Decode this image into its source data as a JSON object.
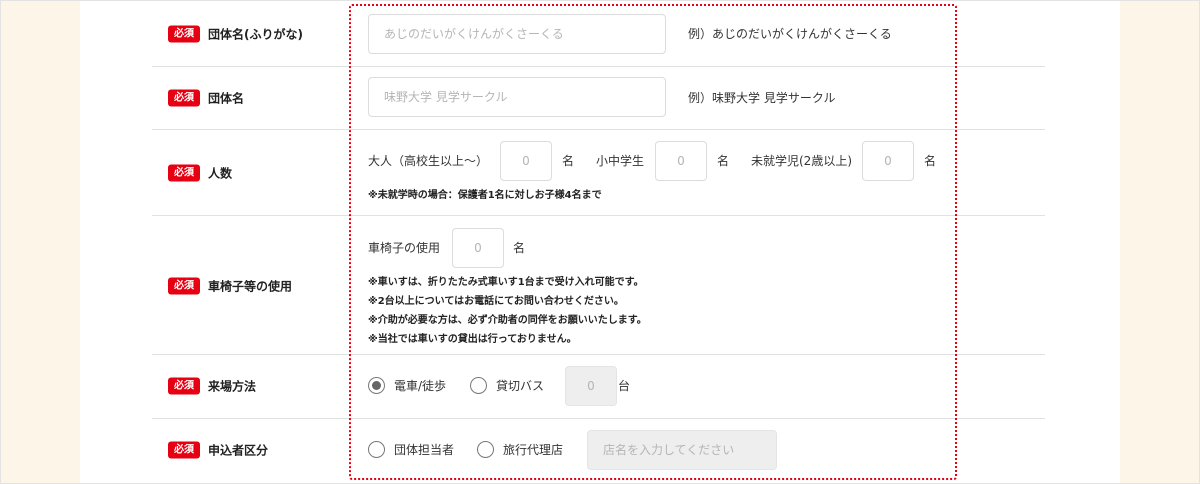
{
  "required_badge": "必須",
  "rows": {
    "group_kana": {
      "label": "団体名(ふりがな)",
      "placeholder": "あじのだいがくけんがくさーくる",
      "example": "例）あじのだいがくけんがくさーくる"
    },
    "group_name": {
      "label": "団体名",
      "placeholder": "味野大学 見学サークル",
      "example": "例）味野大学 見学サークル"
    },
    "headcount": {
      "label": "人数",
      "adult_label": "大人（高校生以上〜）",
      "adult_value": "0",
      "child_label": "小中学生",
      "child_value": "0",
      "infant_label": "未就学児(2歳以上)",
      "infant_value": "0",
      "unit": "名",
      "note": "※未就学時の場合：保護者1名に対しお子様4名まで"
    },
    "wheelchair": {
      "label": "車椅子等の使用",
      "field_label": "車椅子の使用",
      "value": "0",
      "unit": "名",
      "notes": [
        "※車いすは、折りたたみ式車いす1台まで受け入れ可能です。",
        "※2台以上についてはお電話にてお問い合わせください。",
        "※介助が必要な方は、必ず介助者の同伴をお願いいたします。",
        "※当社では車いすの貸出は行っておりません。"
      ]
    },
    "transport": {
      "label": "来場方法",
      "option_train": "電車/徒歩",
      "option_bus": "貸切バス",
      "bus_count": "0",
      "bus_unit": "台",
      "selected": "電車/徒歩"
    },
    "applicant": {
      "label": "申込者区分",
      "option_group": "団体担当者",
      "option_agency": "旅行代理店",
      "store_placeholder": "店名を入力してください"
    }
  },
  "colors": {
    "required_red": "#e60012",
    "side_bg": "#fdf5e7"
  }
}
